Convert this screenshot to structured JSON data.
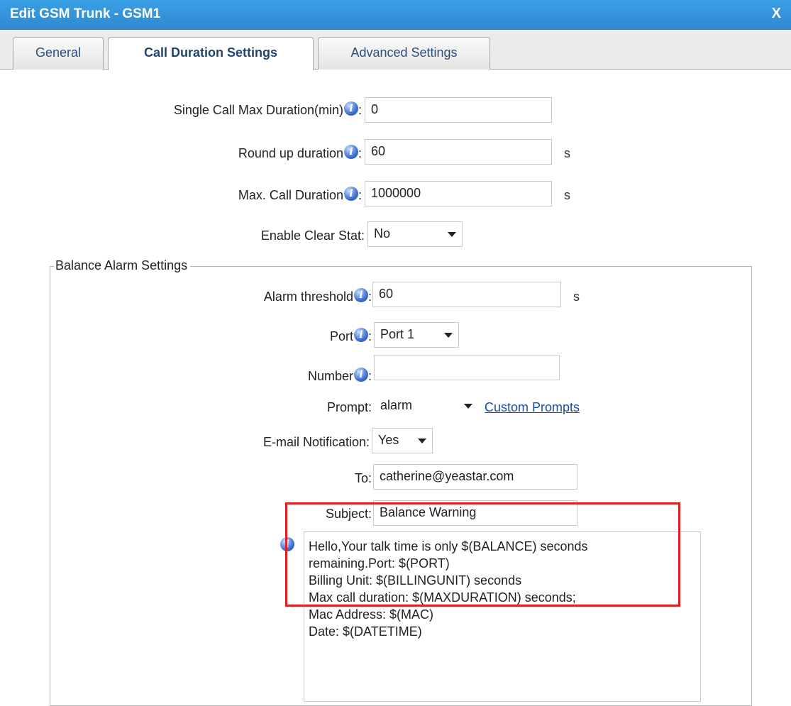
{
  "window": {
    "title": "Edit GSM Trunk - GSM1",
    "close_label": "X"
  },
  "tabs": [
    {
      "label": "General"
    },
    {
      "label": "Call Duration Settings"
    },
    {
      "label": "Advanced Settings"
    }
  ],
  "form": {
    "single_call_max": {
      "label": "Single Call Max Duration(min)",
      "colon": ":",
      "value": "0"
    },
    "round_up": {
      "label": "Round up duration",
      "colon": ":",
      "value": "60",
      "unit": "s"
    },
    "max_call": {
      "label": "Max. Call Duration",
      "colon": ":",
      "value": "1000000",
      "unit": "s"
    },
    "enable_clear": {
      "label": "Enable Clear Stat:",
      "value": "No"
    }
  },
  "balance_alarm": {
    "legend": "Balance Alarm Settings",
    "threshold": {
      "label": "Alarm threshold",
      "colon": ":",
      "value": "60",
      "unit": "s"
    },
    "port": {
      "label": "Port",
      "colon": ":",
      "value": "Port 1"
    },
    "number": {
      "label": "Number",
      "colon": ":",
      "value": ""
    },
    "prompt": {
      "label": "Prompt:",
      "value": "alarm",
      "link": "Custom Prompts"
    },
    "email_notification": {
      "label": "E-mail Notification:",
      "value": "Yes"
    },
    "to": {
      "label": "To:",
      "value": "catherine@yeastar.com"
    },
    "subject": {
      "label": "Subject:",
      "value": "Balance Warning"
    },
    "body": [
      "Hello,Your talk time is only $(BALANCE) seconds",
      "remaining.Port: $(PORT)",
      "Billing Unit: $(BILLINGUNIT) seconds",
      "Max call duration: $(MAXDURATION) seconds;",
      "Mac Address: $(MAC)",
      "Date: $(DATETIME)"
    ]
  },
  "icons": {
    "info": "info-icon",
    "dropdown": "chevron-down-icon"
  },
  "colors": {
    "titlebar": "#2f88cf",
    "link": "#1a4fa8",
    "highlight": "#e01f1f"
  }
}
